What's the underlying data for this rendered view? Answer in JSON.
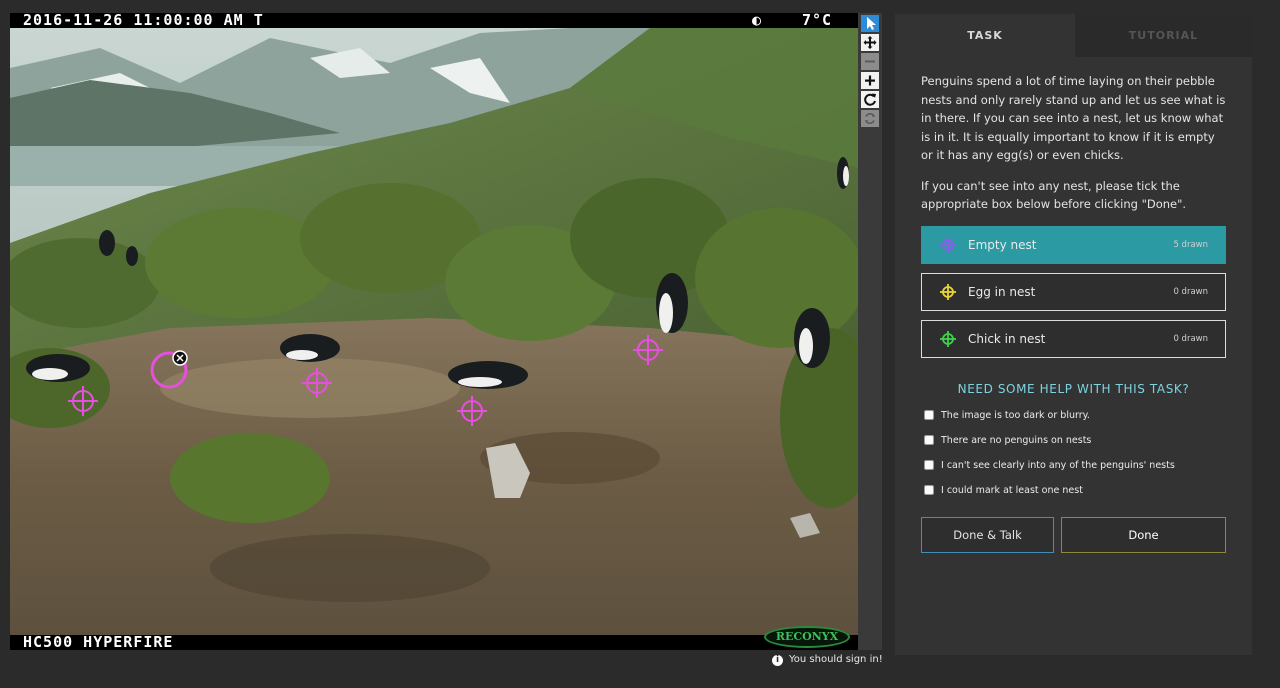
{
  "viewer": {
    "date_stamp": "2016-11-26  11:00:00 AM    T",
    "moon_glyph": "◐",
    "temperature": "7°C",
    "camera_model": "HC500 HYPERFIRE",
    "brand_logo_text": "RECONYX",
    "marker_color": "#e64fe0"
  },
  "toolbar": {
    "pointer": "pointer-icon",
    "pan": "move-icon",
    "zoom_out": "minus-icon",
    "zoom_in": "plus-icon",
    "rotate": "rotate-icon",
    "reset": "reset-icon"
  },
  "notice": {
    "sign_in": "You should sign in!"
  },
  "tabs": {
    "task": "TASK",
    "tutorial": "TUTORIAL"
  },
  "instructions": {
    "p1": "Penguins spend a lot of time laying on their pebble nests and only rarely stand up and let us see what is in there. If you can see into a nest, let us know what is in it. It is equally important to know if it is empty or it has any egg(s) or even chicks.",
    "p2": "If you can't see into any nest, please tick the appropriate box below before clicking \"Done\"."
  },
  "tools": [
    {
      "label": "Empty nest",
      "count": "5 drawn",
      "color": "#8a5ee8"
    },
    {
      "label": "Egg in nest",
      "count": "0 drawn",
      "color": "#e8d62e"
    },
    {
      "label": "Chick in nest",
      "count": "0 drawn",
      "color": "#3ed24a"
    }
  ],
  "help": {
    "title": "NEED SOME HELP WITH THIS TASK?",
    "options": [
      "The image is too dark or blurry.",
      "There are no penguins on nests",
      "I can't see clearly into any of the penguins' nests",
      "I could mark at least one nest"
    ]
  },
  "actions": {
    "done_talk": "Done & Talk",
    "done": "Done"
  }
}
